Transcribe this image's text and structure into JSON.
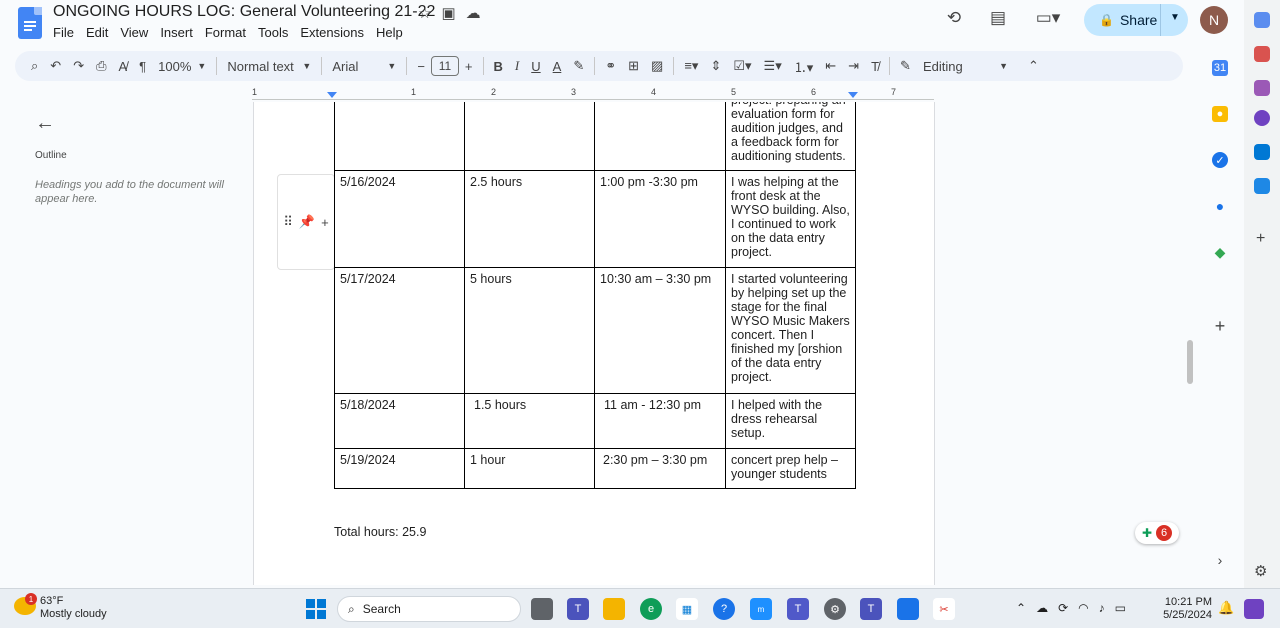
{
  "document": {
    "title": "ONGOING HOURS LOG: General Volunteering 21-22",
    "menu": [
      "File",
      "Edit",
      "View",
      "Insert",
      "Format",
      "Tools",
      "Extensions",
      "Help"
    ],
    "share_label": "Share",
    "avatar_letter": "N"
  },
  "toolbar": {
    "zoom": "100%",
    "style": "Normal text",
    "font": "Arial",
    "font_size": "11",
    "mode": "Editing",
    "bold": "B",
    "italic": "I",
    "underline": "U",
    "text_color": "A"
  },
  "ruler": {
    "numbers": [
      "1",
      "1",
      "2",
      "3",
      "4",
      "5",
      "6",
      "7"
    ]
  },
  "outline": {
    "title": "Outline",
    "hint": "Headings you add to the document will appear here."
  },
  "table": {
    "rows": [
      [
        "",
        "",
        "",
        "project: preparing an evaluation form for audition judges, and a feedback form for auditioning students."
      ],
      [
        "5/16/2024",
        "2.5 hours",
        "1:00 pm -3:30 pm",
        "I was helping at the front desk at the WYSO building. Also, I continued to work on the data entry project."
      ],
      [
        "5/17/2024",
        "5 hours",
        "10:30 am – 3:30 pm",
        "I started volunteering by helping set up the stage for the final WYSO Music Makers concert. Then I finished my [orshion of the data entry project."
      ],
      [
        "5/18/2024",
        "1.5 hours",
        "11 am - 12:30 pm",
        "I helped with the dress rehearsal setup."
      ],
      [
        "5/19/2024",
        "1 hour",
        "2:30 pm – 3:30 pm",
        "concert prep help – younger students"
      ]
    ]
  },
  "total": "Total hours: 25.9",
  "bubble_count": "6",
  "taskbar": {
    "weather_temp": "63°F",
    "weather_cond": "Mostly cloudy",
    "weather_badge": "1",
    "search_label": "Search",
    "time": "10:21 PM",
    "date": "5/25/2024"
  }
}
